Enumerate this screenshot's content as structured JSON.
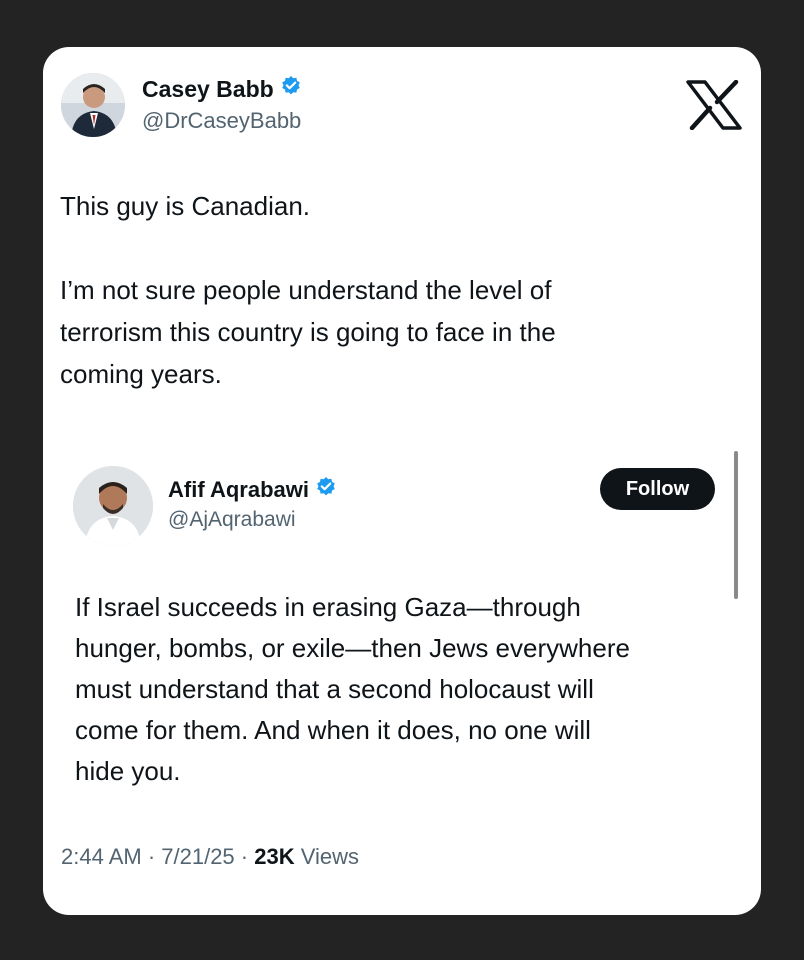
{
  "tweet": {
    "author": {
      "name": "Casey Babb",
      "handle": "@DrCaseyBabb",
      "avatar_icon": "user-avatar"
    },
    "platform_icon": "x-logo-icon",
    "text_line1": "This guy is Canadian.",
    "text_paragraph2": "I’m not sure people understand the level of\nterrorism this country is going to face in the\ncoming years."
  },
  "embedded": {
    "author": {
      "name": "Afif Aqrabawi",
      "handle": "@AjAqrabawi",
      "avatar_icon": "user-avatar"
    },
    "follow_label": "Follow",
    "text": "If Israel succeeds in erasing Gaza—through\nhunger, bombs, or exile—then Jews everywhere\nmust understand that a second holocaust will\ncome for them. And when it does, no one will\nhide you."
  },
  "meta": {
    "time_date": "2:44 AM · 7/21/25 · ",
    "views_count": "23K",
    "views_label": " Views"
  },
  "colors": {
    "background": "#232323",
    "card": "#ffffff",
    "text": "#0f1419",
    "secondary_text": "#536471",
    "verified_blue": "#1d9bf0",
    "follow_button": "#0f1419"
  }
}
